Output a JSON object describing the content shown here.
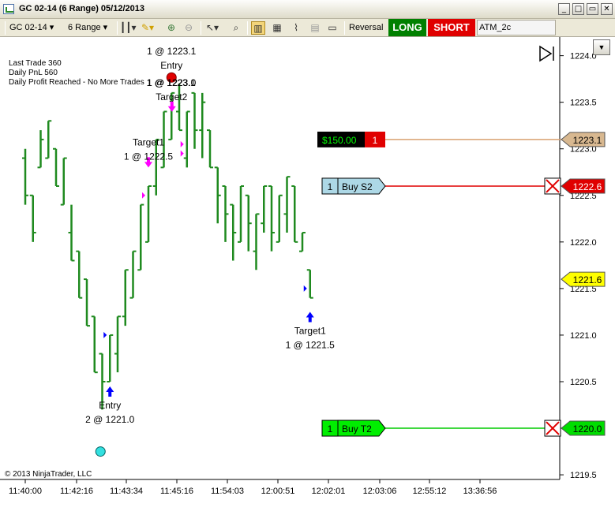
{
  "window": {
    "title": "GC 02-14 (6 Range)  05/12/2013",
    "minimize": "_",
    "maximize": "□",
    "close": "✕"
  },
  "toolbar": {
    "instrument": "GC 02-14",
    "period": "6 Range",
    "reversal_label": "Reversal",
    "long_label": "LONG",
    "short_label": "SHORT",
    "atm_strategy": "ATM_2c",
    "icons": [
      "bars-type-icon",
      "pencil-draw-icon",
      "zoom-in-icon",
      "zoom-out-icon",
      "cursor-icon",
      "magnifier-icon",
      "chart-trader-icon",
      "data-box-icon",
      "indicators-icon",
      "strategies-icon",
      "properties-icon"
    ]
  },
  "info": {
    "last_trade": "Last Trade 360",
    "daily_pnl": "Daily PnL  560",
    "daily_profit": "Daily Profit Reached - No More Trades",
    "copyright": "© 2013 NinjaTrader, LLC"
  },
  "colors": {
    "bars": "#1f8a1f",
    "long_button": "#008000",
    "short_button": "#e00000",
    "stop_line": "#e00000",
    "target_line": "#00cc00",
    "pnl_line": "#d8a070",
    "arrow_blue": "#0000ff",
    "arrow_magenta": "#ff00ff"
  },
  "chart_data": {
    "type": "bar",
    "y_range": [
      1219.45,
      1224.2
    ],
    "y_ticks": [
      1219.5,
      1220.0,
      1220.5,
      1221.0,
      1221.5,
      1222.0,
      1222.5,
      1223.0,
      1223.5,
      1224.0
    ],
    "y_tick_labels": [
      "1219.5",
      "1220.0",
      "1220.5",
      "1221.0",
      "1221.5",
      "1222.0",
      "1222.5",
      "1223.0",
      "1223.5",
      "1224.0"
    ],
    "x_tick_labels": [
      "11:40:00",
      "11:42:16",
      "11:43:34",
      "11:45:16",
      "11:54:03",
      "12:00:51",
      "12:02:01",
      "12:03:06",
      "12:55:12",
      "13:36:56"
    ],
    "bars": [
      [
        1222.9,
        1223.0,
        1222.4,
        1222.5
      ],
      [
        1222.5,
        1222.5,
        1222.0,
        1222.1
      ],
      [
        1222.8,
        1223.2,
        1222.8,
        1223.1
      ],
      [
        1222.9,
        1223.3,
        1222.9,
        1223.3
      ],
      [
        1223.0,
        1223.0,
        1222.6,
        1222.6
      ],
      [
        1222.4,
        1222.9,
        1222.4,
        1222.9
      ],
      [
        1222.1,
        1222.4,
        1221.8,
        1221.8
      ],
      [
        1221.9,
        1221.9,
        1221.4,
        1221.4
      ],
      [
        1221.6,
        1221.6,
        1221.1,
        1221.1
      ],
      [
        1221.2,
        1221.2,
        1220.6,
        1220.6
      ],
      [
        1220.8,
        1220.8,
        1220.2,
        1220.5
      ],
      [
        1220.5,
        1221.0,
        1220.5,
        1221.0
      ],
      [
        1220.8,
        1221.2,
        1220.6,
        1221.2
      ],
      [
        1221.2,
        1221.7,
        1221.1,
        1221.7
      ],
      [
        1221.4,
        1221.9,
        1221.4,
        1221.9
      ],
      [
        1221.7,
        1222.4,
        1221.7,
        1222.4
      ],
      [
        1222.0,
        1222.6,
        1222.0,
        1222.6
      ],
      [
        1222.6,
        1223.1,
        1222.5,
        1223.1
      ],
      [
        1222.8,
        1223.4,
        1222.8,
        1223.4
      ],
      [
        1223.1,
        1223.6,
        1223.1,
        1223.6
      ],
      [
        1223.4,
        1223.7,
        1223.2,
        1223.2
      ],
      [
        1222.9,
        1223.4,
        1222.8,
        1223.4
      ],
      [
        1223.6,
        1223.6,
        1223.0,
        1223.2
      ],
      [
        1223.2,
        1223.6,
        1222.9,
        1223.5
      ],
      [
        1223.2,
        1223.2,
        1222.8,
        1222.8
      ],
      [
        1222.8,
        1222.8,
        1222.2,
        1222.5
      ],
      [
        1222.6,
        1222.6,
        1222.0,
        1222.3
      ],
      [
        1222.4,
        1222.4,
        1221.8,
        1222.1
      ],
      [
        1222.0,
        1222.6,
        1222.0,
        1222.6
      ],
      [
        1222.5,
        1222.5,
        1221.9,
        1222.2
      ],
      [
        1221.9,
        1222.3,
        1221.7,
        1222.3
      ],
      [
        1222.2,
        1222.6,
        1222.1,
        1222.6
      ],
      [
        1222.6,
        1222.6,
        1221.9,
        1222.1
      ],
      [
        1222.0,
        1222.5,
        1222.0,
        1222.5
      ],
      [
        1222.3,
        1222.7,
        1222.1,
        1222.7
      ],
      [
        1222.6,
        1222.6,
        1222.0,
        1222.0
      ],
      [
        1221.9,
        1222.1,
        1221.9,
        1222.1
      ],
      [
        1221.7,
        1221.7,
        1221.4,
        1221.4
      ]
    ],
    "price_markers": [
      {
        "label": "1223.1",
        "price": 1223.1,
        "color": "#d8b890",
        "text_color": "#000000"
      },
      {
        "label": "1222.6",
        "price": 1222.6,
        "color": "#e00000",
        "text_color": "#ffffff"
      },
      {
        "label": "1221.6",
        "price": 1221.6,
        "color": "#ffff00",
        "text_color": "#000000"
      },
      {
        "label": "1220.0",
        "price": 1220.0,
        "color": "#00dd00",
        "text_color": "#000000"
      }
    ],
    "order_lines": [
      {
        "price": 1223.1,
        "line_color": "#d8a070",
        "tag_left": "$150.00",
        "tag_right": "1",
        "style": "pnl"
      },
      {
        "price": 1222.6,
        "line_color": "#e00000",
        "tag_left": "1",
        "tag_right": "Buy S2",
        "style": "stop"
      },
      {
        "price": 1220.0,
        "line_color": "#00cc00",
        "tag_left": "1",
        "tag_right": "Buy T2",
        "style": "target"
      }
    ],
    "annotations": [
      {
        "bar": 11,
        "line1": "Entry",
        "line2": "2 @ 1221.0",
        "side": "below",
        "arrow": "up-blue",
        "price": 1220.5
      },
      {
        "bar": 16,
        "line1": "Target1",
        "line2": "1 @ 1222.5",
        "side": "above",
        "arrow": "down-magenta",
        "price": 1222.8
      },
      {
        "bar": 19,
        "line1": "1 @ 1223.1",
        "line2": "Entry",
        "side": "above-dot",
        "arrow": "red-dot",
        "price": 1223.8
      },
      {
        "bar": 19,
        "line1": "1 @ 1223.0",
        "line2": "Target2",
        "side": "above2",
        "arrow": "",
        "price": 1223.6
      },
      {
        "bar": 21,
        "line1": "1 @ 1223.1",
        "line2": "",
        "side": "above3",
        "arrow": "down-magenta",
        "price": 1223.55
      },
      {
        "bar": 37,
        "line1": "Target1",
        "line2": "1 @ 1221.5",
        "side": "below",
        "arrow": "up-blue",
        "price": 1221.3
      }
    ]
  }
}
